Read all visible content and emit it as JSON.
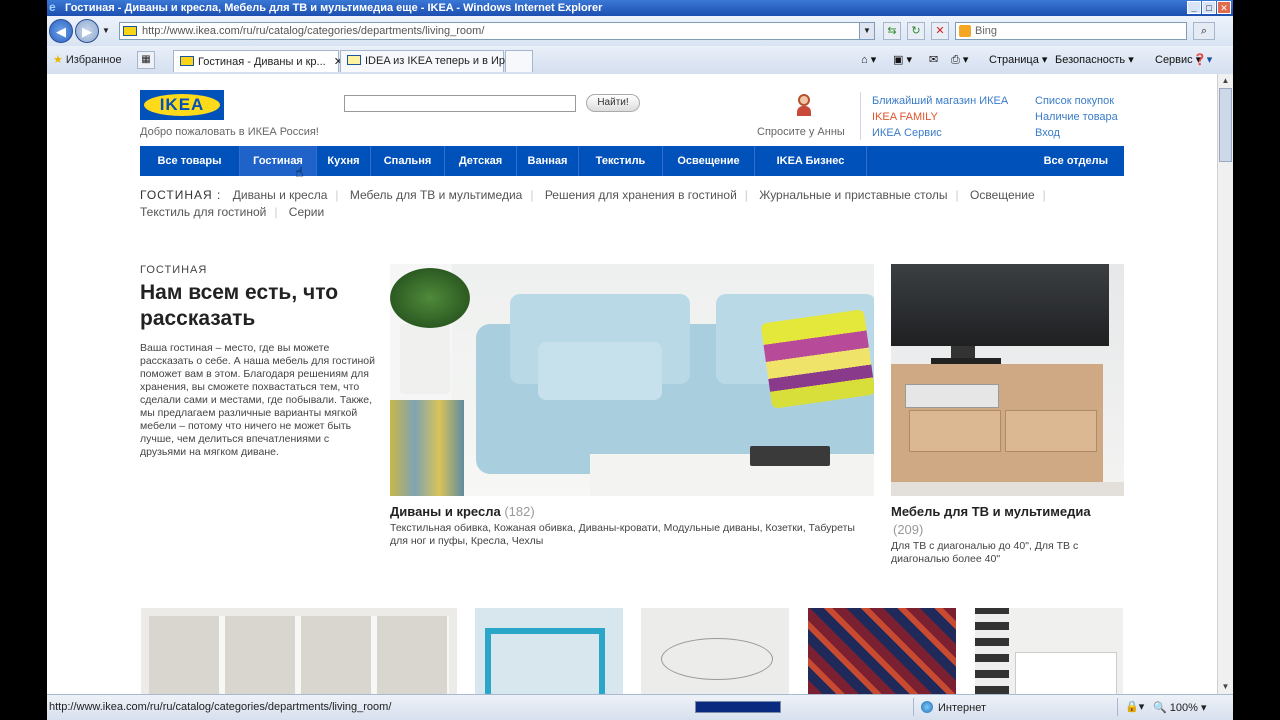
{
  "window": {
    "title": "Гостиная - Диваны и кресла, Мебель для ТВ и мультимедиа еще - IKEA - Windows Internet Explorer"
  },
  "browser": {
    "url": "http://www.ikea.com/ru/ru/catalog/categories/departments/living_room/",
    "search_placeholder": "Bing",
    "favorites_label": "Избранное",
    "tabs": [
      {
        "label": "Гостиная - Диваны и кр...",
        "active": true
      },
      {
        "label": "IDEA из IKEA теперь и в Ир...",
        "active": false
      }
    ],
    "commands": {
      "page": "Страница",
      "safety": "Безопасность",
      "tools": "Сервис"
    },
    "status_url": "http://www.ikea.com/ru/ru/catalog/categories/departments/living_room/",
    "zone": "Интернет",
    "zoom": "100%"
  },
  "header": {
    "logo_text": "IKEA",
    "welcome": "Добро пожаловать в ИКЕА Россия!",
    "search_button": "Найти!",
    "ask_anna": "Спросите у Анны",
    "links_col1": [
      "Ближайший магазин ИКЕА",
      "IKEA FAMILY",
      "ИКЕА Сервис"
    ],
    "links_col2": [
      "Список покупок",
      "Наличие товара",
      "Вход"
    ]
  },
  "nav": {
    "items": [
      "Все товары",
      "Гостиная",
      "Кухня",
      "Спальня",
      "Детская",
      "Ванная",
      "Текстиль",
      "Освещение",
      "IKEA Бизнес"
    ],
    "all_departments": "Все отделы"
  },
  "subnav": {
    "section": "ГОСТИНАЯ :",
    "items": [
      "Диваны и кресла",
      "Мебель для ТВ и мультимедиа",
      "Решения для хранения в гостиной",
      "Журнальные и приставные столы",
      "Освещение",
      "Текстиль для гостиной",
      "Серии"
    ]
  },
  "intro": {
    "kicker": "ГОСТИНАЯ",
    "headline": "Нам всем есть, что рассказать",
    "body": "Ваша гостиная – место, где вы можете рассказать о себе. А наша мебель для гостиной поможет вам в этом. Благодаря решениям для хранения, вы сможете похвастаться тем, что сделали сами и местами, где побывали. Также, мы предлагаем различные варианты мягкой мебели – потому что ничего не может быть лучше, чем делиться впечатлениями с друзьями на мягком диване."
  },
  "categories": [
    {
      "title": "Диваны и кресла",
      "count": "(182)",
      "desc": "Текстильная обивка, Кожаная обивка, Диваны-кровати, Модульные диваны, Козетки, Табуреты для ног и пуфы, Кресла, Чехлы"
    },
    {
      "title": "Мебель для ТВ и мультимедиа",
      "count": "(209)",
      "desc": "Для ТВ с диагональю до 40\", Для ТВ с диагональю более 40\""
    }
  ]
}
